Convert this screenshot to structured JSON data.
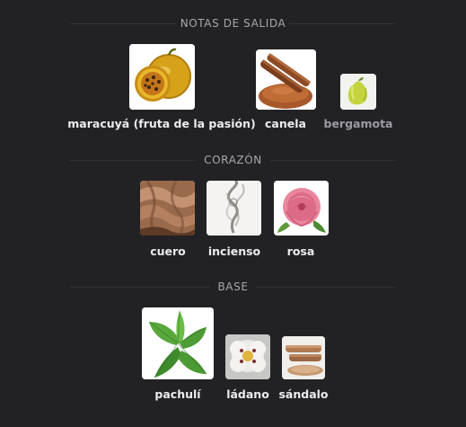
{
  "sections": {
    "top": {
      "title": "NOTAS DE SALIDA",
      "notes": [
        {
          "name": "maracuyá (fruta de la pasión)",
          "icon": "passion-fruit-icon"
        },
        {
          "name": "canela",
          "icon": "cinnamon-icon"
        },
        {
          "name": "bergamota",
          "icon": "bergamot-icon"
        }
      ]
    },
    "heart": {
      "title": "CORAZÓN",
      "notes": [
        {
          "name": "cuero",
          "icon": "leather-icon"
        },
        {
          "name": "incienso",
          "icon": "incense-icon"
        },
        {
          "name": "rosa",
          "icon": "rose-icon"
        }
      ]
    },
    "base": {
      "title": "BASE",
      "notes": [
        {
          "name": "pachulí",
          "icon": "patchouli-icon"
        },
        {
          "name": "ládano",
          "icon": "labdanum-icon"
        },
        {
          "name": "sándalo",
          "icon": "sandalwood-icon"
        }
      ]
    }
  },
  "colors": {
    "background": "#222225",
    "section_title": "#a6a6ad",
    "label": "#ececee",
    "label_dim": "#9b9ba2"
  }
}
